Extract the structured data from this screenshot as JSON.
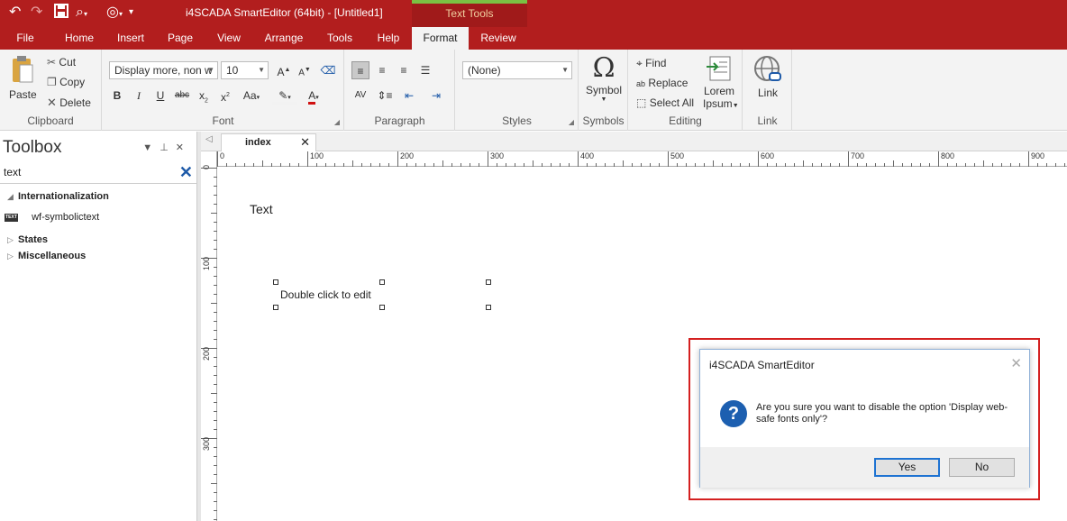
{
  "app": {
    "title": "i4SCADA SmartEditor (64bit) - [Untitled1]",
    "contextual_tab": "Text Tools"
  },
  "tabs": [
    "File",
    "Home",
    "Insert",
    "Page",
    "View",
    "Arrange",
    "Tools",
    "Help",
    "Format",
    "Review"
  ],
  "active_tab": "Format",
  "ribbon": {
    "clipboard": {
      "label": "Clipboard",
      "paste": "Paste",
      "cut": "Cut",
      "copy": "Copy",
      "delete": "Delete"
    },
    "font": {
      "label": "Font",
      "family": "Display more, non w",
      "size": "10"
    },
    "paragraph": {
      "label": "Paragraph"
    },
    "styles": {
      "label": "Styles",
      "value": "(None)"
    },
    "symbols": {
      "label": "Symbols",
      "symbol": "Symbol"
    },
    "editing": {
      "label": "Editing",
      "find": "Find",
      "replace": "Replace",
      "select_all": "Select All",
      "lorem_line1": "Lorem",
      "lorem_line2": "Ipsum"
    },
    "link": {
      "label": "Link",
      "link": "Link"
    }
  },
  "toolbox": {
    "title": "Toolbox",
    "search_value": "text",
    "categories": [
      {
        "name": "Internationalization",
        "expanded": true,
        "items": [
          {
            "icon_text": "TEXT",
            "label": "wf-symbolictext"
          }
        ]
      },
      {
        "name": "States",
        "expanded": false
      },
      {
        "name": "Miscellaneous",
        "expanded": false
      }
    ]
  },
  "document": {
    "tab": "index",
    "ruler_h": [
      "0",
      "100",
      "200",
      "300",
      "400",
      "500",
      "600",
      "700",
      "800",
      "900"
    ],
    "ruler_v": [
      "0",
      "100",
      "200",
      "300"
    ],
    "canvas_text": "Text",
    "selected_text": "Double click to edit"
  },
  "dialog": {
    "title": "i4SCADA SmartEditor",
    "message": "Are you sure you want to disable the option 'Display web-safe fonts only'?",
    "yes": "Yes",
    "no": "No"
  },
  "colors": {
    "brand": "#b21e1e",
    "highlight_outline": "#d42020",
    "question_icon": "#1c5fb0",
    "contextual_accent": "#7ac143"
  }
}
